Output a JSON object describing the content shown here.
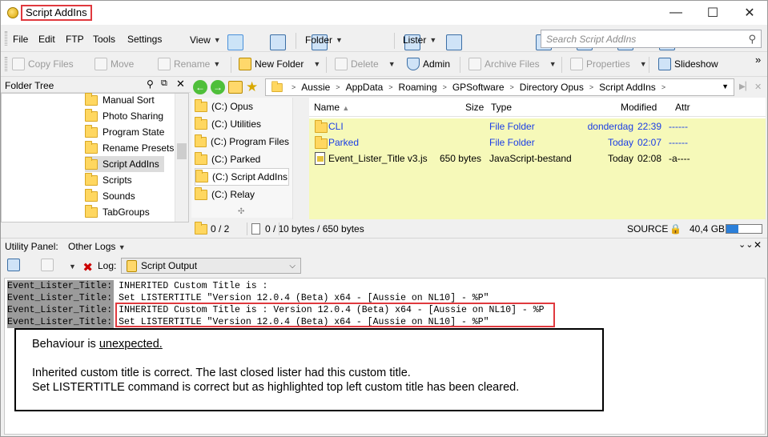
{
  "window": {
    "title": "Script AddIns",
    "minimize": "—",
    "maximize": "☐",
    "close": "✕"
  },
  "menu": [
    "File",
    "Edit",
    "FTP",
    "Tools",
    "Settings"
  ],
  "menu_right": {
    "view": "View",
    "folder": "Folder",
    "lister": "Lister"
  },
  "search": {
    "placeholder": "Search Script AddIns"
  },
  "toolbar": {
    "copy_files": "Copy Files",
    "move": "Move",
    "rename": "Rename",
    "new_folder": "New Folder",
    "delete": "Delete",
    "admin": "Admin",
    "archive_files": "Archive Files",
    "properties": "Properties",
    "slideshow": "Slideshow",
    "overflow": "»"
  },
  "folder_tree": {
    "header": "Folder Tree",
    "items": [
      "Manual Sort",
      "Photo Sharing",
      "Program State",
      "Rename Presets",
      "Script AddIns",
      "Scripts",
      "Sounds",
      "TabGroups"
    ],
    "selected_index": 4
  },
  "favorites": {
    "items": [
      "(C:) Opus",
      "(C:) Utilities",
      "(C:) Program Files",
      "(C:) Parked",
      "(C:) Script AddIns",
      "(C:) Relay"
    ],
    "selected_index": 4,
    "more_glyph": "✣"
  },
  "breadcrumb": [
    "Aussie",
    "AppData",
    "Roaming",
    "GPSoftware",
    "Directory Opus",
    "Script AddIns"
  ],
  "file_list": {
    "columns": {
      "name": "Name",
      "size": "Size",
      "type": "Type",
      "modified": "Modified",
      "attr": "Attr"
    },
    "rows": [
      {
        "name": "CLI",
        "size": "",
        "type": "File Folder",
        "modified_day": "donderdag",
        "modified_time": "22:39",
        "attr": "------",
        "kind": "folder"
      },
      {
        "name": "Parked",
        "size": "",
        "type": "File Folder",
        "modified_day": "Today",
        "modified_time": "02:07",
        "attr": "------",
        "kind": "folder"
      },
      {
        "name": "Event_Lister_Title v3.js",
        "size": "650 bytes",
        "type": "JavaScript-bestand",
        "modified_day": "Today",
        "modified_time": "02:08",
        "attr": "-a----",
        "kind": "file"
      }
    ]
  },
  "status": {
    "folders": "0 / 2",
    "files": "0 / 1",
    "bytes": "0 bytes / 650 bytes",
    "source": "SOURCE",
    "free": "40,4 GB",
    "free_fraction": 0.35
  },
  "utility_panel": {
    "label": "Utility Panel:",
    "tab": "Other Logs",
    "log_label": "Log:",
    "log_selected": "Script Output"
  },
  "log_lines": [
    {
      "src": "Event_Lister_Title:",
      "msg": "INHERITED Custom Title is :"
    },
    {
      "src": "Event_Lister_Title:",
      "msg": "Set LISTERTITLE \"Version 12.0.4 (Beta) x64 - [Aussie on NL10] - %P\""
    },
    {
      "src": "Event_Lister_Title:",
      "msg": "INHERITED Custom Title is : Version 12.0.4 (Beta) x64 - [Aussie on NL10] - %P"
    },
    {
      "src": "Event_Lister_Title:",
      "msg": "Set LISTERTITLE \"Version 12.0.4 (Beta) x64 - [Aussie on NL10] - %P\""
    }
  ],
  "note": {
    "line1_prefix": "Behaviour is ",
    "line1_emph": "unexpected.",
    "line2": "Inherited custom title is correct. The last closed lister had this custom title.",
    "line3": "Set LISTERTITLE command is correct but as highlighted top left custom title has been cleared."
  }
}
